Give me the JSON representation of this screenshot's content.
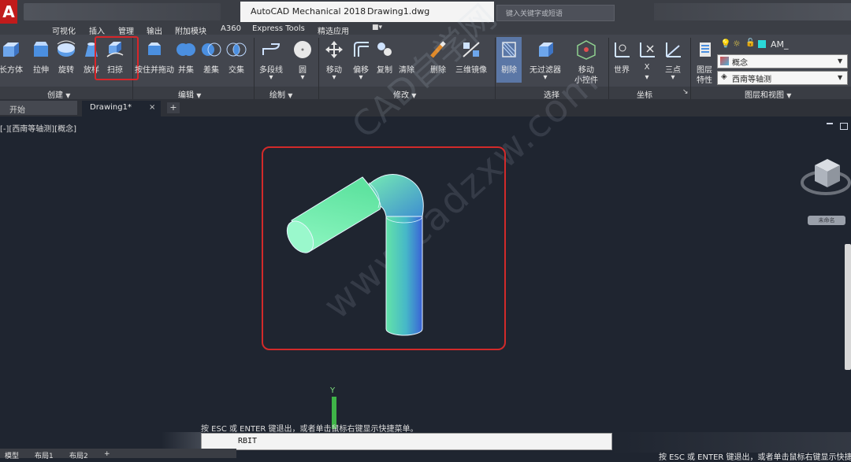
{
  "window": {
    "app_title": "AutoCAD Mechanical 2018",
    "doc_title": "Drawing1.dwg",
    "search_placeholder": "键入关键字或短语",
    "logo": "A"
  },
  "menu": {
    "items": [
      {
        "label": "可视化",
        "x": 0
      },
      {
        "label": "插入"
      },
      {
        "label": "管理"
      },
      {
        "label": "输出"
      },
      {
        "label": "附加模块"
      },
      {
        "label": "A360"
      },
      {
        "label": "Express Tools"
      },
      {
        "label": "精选应用"
      }
    ]
  },
  "ribbon": {
    "create": {
      "panel_label": "创建",
      "box": "长方体",
      "extrude": "拉伸",
      "revolve": "旋转",
      "loft": "放样",
      "sweep": "扫掠"
    },
    "edit": {
      "panel_label": "编辑",
      "presspull": "按住并拖动",
      "union": "并集",
      "subtract": "差集",
      "intersect": "交集"
    },
    "draw": {
      "panel_label": "绘制",
      "polyline": "多段线",
      "circle": "圆"
    },
    "modify": {
      "panel_label": "修改",
      "move": "移动",
      "offset": "偏移",
      "copy": "复制",
      "clean": "清除",
      "delete": "删除",
      "mirror3d": "三维镜像"
    },
    "selection": {
      "panel_label": "选择",
      "cull": "剔除",
      "nofilter": "无过滤器",
      "gizmo_line1": "移动",
      "gizmo_line2": "小控件"
    },
    "coords": {
      "panel_label": "坐标",
      "world": "世界",
      "x": "X",
      "three_point": "三点"
    },
    "layers_views": {
      "panel_label": "图层和视图",
      "layer_props_line1": "图层",
      "layer_props_line2": "特性",
      "layer_name": "AM_",
      "visual_style": "概念",
      "view": "西南等轴测"
    }
  },
  "file_tabs": {
    "start": "开始",
    "drawing": "Drawing1*",
    "close": "×",
    "add": "+"
  },
  "viewport": {
    "label": "[-][西南等轴测][概念]",
    "viewcube_label": "未命名",
    "ucs_y": "Y"
  },
  "watermark": {
    "cn": "CAD自学网",
    "url": "www.cadzxw.com"
  },
  "command": {
    "history": "按 ESC 或 ENTER 键退出，或者单击鼠标右键显示快捷菜单。",
    "current": "RBIT",
    "right_tip": "按 ESC 或 ENTER 键退出，或者单击鼠标右键显示快捷菜单"
  },
  "layout_tabs": {
    "model": "模型",
    "layout1": "布局1",
    "layout2": "布局2",
    "add": "+"
  },
  "colors": {
    "highlight_red": "#d8262a",
    "pipe_green": "#6ff0a0",
    "pipe_blue": "#3b6fd8",
    "background": "#1f2530"
  }
}
